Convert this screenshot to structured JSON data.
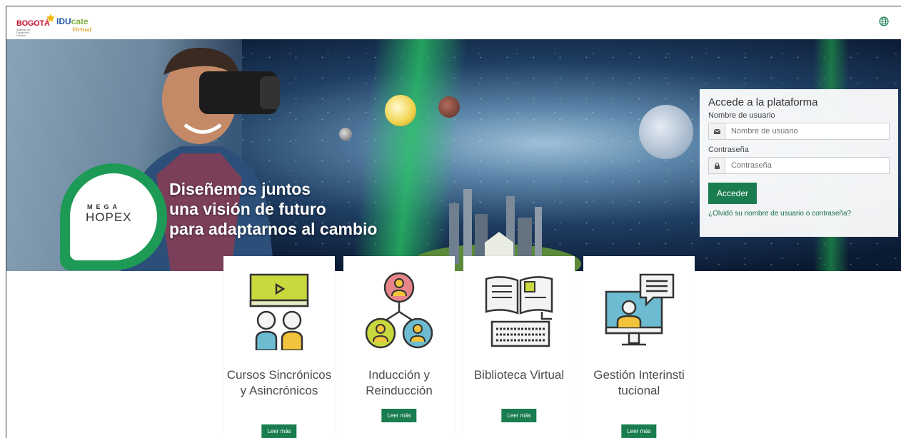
{
  "header": {
    "logo_bogota": "BOGOTÁ",
    "logo_bogota_sub": "Instituto de Desarrollo Urbano",
    "logo_idu": "IDU",
    "logo_cate": "cate",
    "logo_virtual": "Virtual",
    "language_icon": "globe-icon"
  },
  "hero": {
    "badge_mega": "MEGA",
    "badge_hopex": "HOPEX",
    "headline": [
      "Diseñemos juntos",
      "una visión de futuro",
      "para adaptarnos al cambio"
    ]
  },
  "login": {
    "title": "Accede a la plataforma",
    "username_label": "Nombre de usuario",
    "username_placeholder": "Nombre de usuario",
    "username_icon": "envelope-icon",
    "password_label": "Contraseña",
    "password_placeholder": "Contraseña",
    "password_icon": "lock-icon",
    "submit_label": "Acceder",
    "forgot_link": "¿Olvidó su nombre de usuario o contraseña?"
  },
  "cards": [
    {
      "title": "Cursos Sincrónicos y Asincrónicos",
      "button": "Leer más",
      "icon": "video-class-icon"
    },
    {
      "title": "Inducción y Reinducción",
      "button": "Leer más",
      "icon": "people-network-icon"
    },
    {
      "title": "Biblioteca Virtual",
      "button": "Leer más",
      "icon": "book-keyboard-icon"
    },
    {
      "title": "Gestión Interinstitucional",
      "button": "Leer más",
      "icon": "video-chat-icon"
    }
  ],
  "colors": {
    "brand_green": "#1a7d50",
    "badge_green": "#1d9a56",
    "bogota_red": "#c8102e",
    "idu_blue": "#1f5aa6"
  }
}
